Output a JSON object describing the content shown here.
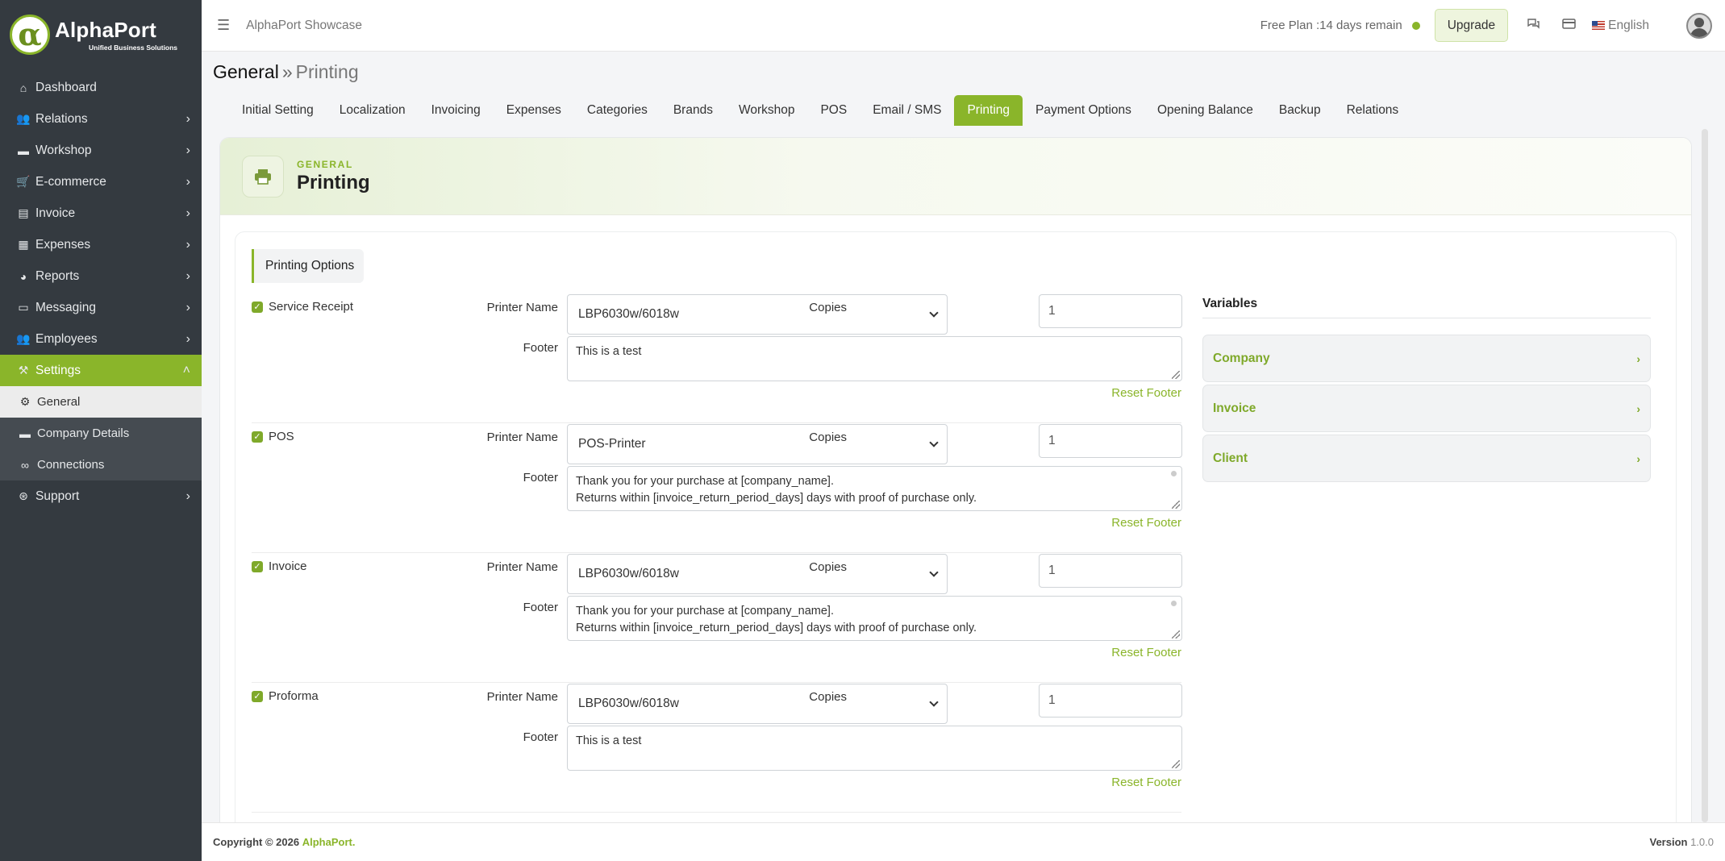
{
  "brand": {
    "name": "AlphaPort",
    "tagline": "Unified Business Solutions",
    "logo_glyph": "α"
  },
  "sidebar": {
    "items": [
      {
        "label": "Dashboard",
        "icon": "home-icon",
        "glyph": "⌂",
        "has_children": false
      },
      {
        "label": "Relations",
        "icon": "users-icon",
        "glyph": "👥",
        "has_children": true
      },
      {
        "label": "Workshop",
        "icon": "briefcase-icon",
        "glyph": "▬",
        "has_children": true
      },
      {
        "label": "E-commerce",
        "icon": "cart-icon",
        "glyph": "🛒",
        "has_children": true
      },
      {
        "label": "Invoice",
        "icon": "file-icon",
        "glyph": "▤",
        "has_children": true
      },
      {
        "label": "Expenses",
        "icon": "money-icon",
        "glyph": "▦",
        "has_children": true
      },
      {
        "label": "Reports",
        "icon": "chart-pie-icon",
        "glyph": "◕",
        "has_children": true
      },
      {
        "label": "Messaging",
        "icon": "comment-icon",
        "glyph": "▭",
        "has_children": true
      },
      {
        "label": "Employees",
        "icon": "people-icon",
        "glyph": "👥",
        "has_children": true
      },
      {
        "label": "Settings",
        "icon": "tools-icon",
        "glyph": "⚒",
        "has_children": true,
        "active": true
      }
    ],
    "settings_children": [
      {
        "label": "General",
        "icon": "cog-icon",
        "glyph": "⚙",
        "selected": true
      },
      {
        "label": "Company Details",
        "icon": "briefcase-icon",
        "glyph": "▬"
      },
      {
        "label": "Connections",
        "icon": "link-icon",
        "glyph": "∞"
      }
    ],
    "support": {
      "label": "Support",
      "icon": "lifebuoy-icon",
      "glyph": "⊛"
    }
  },
  "topbar": {
    "app_title": "AlphaPort Showcase",
    "plan_text": "Free Plan :14 days remain",
    "upgrade_label": "Upgrade",
    "language": "English"
  },
  "breadcrumb": {
    "parent": "General",
    "separator": "»",
    "current": "Printing"
  },
  "tabs": [
    {
      "label": "Initial Setting"
    },
    {
      "label": "Localization"
    },
    {
      "label": "Invoicing"
    },
    {
      "label": "Expenses"
    },
    {
      "label": "Categories"
    },
    {
      "label": "Brands"
    },
    {
      "label": "Workshop"
    },
    {
      "label": "POS"
    },
    {
      "label": "Email / SMS"
    },
    {
      "label": "Printing",
      "active": true
    },
    {
      "label": "Payment Options"
    },
    {
      "label": "Opening Balance"
    },
    {
      "label": "Backup"
    },
    {
      "label": "Relations"
    }
  ],
  "card": {
    "eyebrow": "GENERAL",
    "title": "Printing"
  },
  "section_title": "Printing Options",
  "labels": {
    "printer_name": "Printer Name",
    "copies": "Copies",
    "footer": "Footer",
    "reset_footer": "Reset Footer"
  },
  "print_options": [
    {
      "name": "Service Receipt",
      "checked": true,
      "printer": "LBP6030w/6018w",
      "copies": "1",
      "footer": "This is a test"
    },
    {
      "name": "POS",
      "checked": true,
      "printer": "POS-Printer",
      "copies": "1",
      "footer": "Thank you for your purchase at [company_name].\nReturns within [invoice_return_period_days] days with proof of purchase only."
    },
    {
      "name": "Invoice",
      "checked": true,
      "printer": "LBP6030w/6018w",
      "copies": "1",
      "footer": "Thank you for your purchase at [company_name].\nReturns within [invoice_return_period_days] days with proof of purchase only."
    },
    {
      "name": "Proforma",
      "checked": true,
      "printer": "LBP6030w/6018w",
      "copies": "1",
      "footer": "This is a test"
    }
  ],
  "variables": {
    "title": "Variables",
    "items": [
      {
        "label": "Company"
      },
      {
        "label": "Invoice"
      },
      {
        "label": "Client"
      }
    ]
  },
  "footer": {
    "copyright": "Copyright © 2026",
    "brand": "AlphaPort.",
    "version_label": "Version",
    "version_number": "1.0.0"
  },
  "colors": {
    "accent": "#8ab52a",
    "sidebar_bg": "#343a40"
  }
}
